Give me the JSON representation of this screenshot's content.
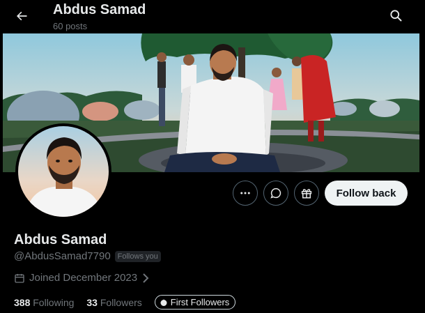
{
  "header": {
    "title": "Abdus Samad",
    "post_count": "60 posts",
    "back_icon": "arrow-left-icon",
    "search_icon": "search-icon"
  },
  "profile": {
    "display_name": "Abdus Samad",
    "handle": "@AbdusSamad7790",
    "follows_you_badge": "Follows you",
    "joined": "Joined December 2023",
    "following_count": "388",
    "following_label": "Following",
    "followers_count": "33",
    "followers_label": "Followers",
    "first_followers_label": "First Followers"
  },
  "actions": {
    "more_icon": "more-horizontal-icon",
    "message_icon": "message-icon",
    "gift_icon": "gift-icon",
    "follow_back_label": "Follow back"
  },
  "colors": {
    "background": "#000000",
    "text_primary": "#e7e9ea",
    "text_secondary": "#71767b",
    "follow_button_bg": "#eff3f4",
    "border": "#536471"
  }
}
